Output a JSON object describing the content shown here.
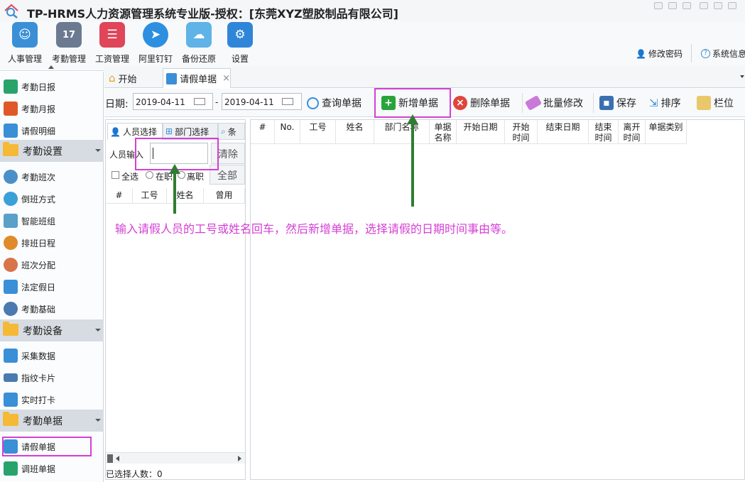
{
  "title": "TP-HRMS人力资源管理系统专业版-授权：[东莞XYZ塑胶制品有限公司]",
  "ribbon": [
    {
      "label": "人事管理",
      "icon": "people-icon",
      "color": "#3a8fd6"
    },
    {
      "label": "考勤管理",
      "icon": "calendar-icon",
      "color": "#6b7a91",
      "active": true
    },
    {
      "label": "工资管理",
      "icon": "payroll-icon",
      "color": "#e0455a"
    },
    {
      "label": "阿里钉钉",
      "icon": "dingtalk-icon",
      "color": "#2d8fe0"
    },
    {
      "label": "备份还原",
      "icon": "cloud-icon",
      "color": "#5fb3e6"
    },
    {
      "label": "设置",
      "icon": "gear-icon",
      "color": "#2f86d9"
    }
  ],
  "top_links": {
    "change_password": "修改密码",
    "system_info": "系统信息"
  },
  "sidebar": {
    "items1": [
      {
        "label": "考勤日报",
        "icon": "book-icon",
        "color": "#2aa36b"
      },
      {
        "label": "考勤月报",
        "icon": "bar-chart-icon",
        "color": "#e0582a"
      },
      {
        "label": "请假明细",
        "icon": "leave-detail-icon",
        "color": "#3a8fd6"
      }
    ],
    "group1": "考勤设置",
    "items2": [
      {
        "label": "考勤班次",
        "icon": "clock-icon",
        "color": "#4a90c8"
      },
      {
        "label": "倒班方式",
        "icon": "rotate-icon",
        "color": "#3aa0d8"
      },
      {
        "label": "智能班组",
        "icon": "smart-group-icon",
        "color": "#5aa0c8"
      },
      {
        "label": "排班日程",
        "icon": "stopwatch-icon",
        "color": "#e08a2a"
      },
      {
        "label": "班次分配",
        "icon": "user-assign-icon",
        "color": "#d9734a"
      },
      {
        "label": "法定假日",
        "icon": "holiday-icon",
        "color": "#3a8fd6"
      },
      {
        "label": "考勤基础",
        "icon": "gear-icon",
        "color": "#4a7ab0"
      }
    ],
    "group2": "考勤设备",
    "items3": [
      {
        "label": "采集数据",
        "icon": "download-icon",
        "color": "#3a8fd6"
      },
      {
        "label": "指纹卡片",
        "icon": "card-icon",
        "color": "#4a7ab0"
      },
      {
        "label": "实时打卡",
        "icon": "monitor-icon",
        "color": "#3a8fd6"
      }
    ],
    "group3": "考勤单据",
    "items4": [
      {
        "label": "请假单据",
        "icon": "leave-form-icon",
        "color": "#3a8fd6",
        "selected": true
      },
      {
        "label": "调班单据",
        "icon": "shift-form-icon",
        "color": "#2aa36b"
      }
    ]
  },
  "tabs": {
    "home": "开始",
    "leave": "请假单据",
    "close": "×"
  },
  "toolbar": {
    "date_label": "日期:",
    "date_from": "2019-04-11",
    "date_sep": "-",
    "date_to": "2019-04-11",
    "query": "查询单据",
    "add": "新增单据",
    "delete": "删除单据",
    "batch": "批量修改",
    "save": "保存",
    "sort": "排序",
    "columns": "栏位"
  },
  "left_panel": {
    "tab_people": "人员选择",
    "tab_dept": "部门选择",
    "tab_cond": "条",
    "input_label": "人员输入",
    "input_value": "",
    "clear": "清除",
    "select_all": "全选",
    "on_job": "在职",
    "resigned": "离职",
    "all": "全部",
    "headers": [
      "#",
      "工号",
      "姓名",
      "曾用"
    ],
    "selected_count": "已选择人数：0"
  },
  "grid": {
    "headers": [
      "#",
      "No.",
      "工号",
      "姓名",
      "部门名称",
      "单据名称",
      "开始日期",
      "开始时间",
      "结束日期",
      "结束时间",
      "离开时间",
      "单据类别"
    ]
  },
  "annotation": "输入请假人员的工号或姓名回车，然后新增单据，选择请假的日期时间事由等。",
  "colors": {
    "highlight": "#d43fd4",
    "arrow": "#2e7d32"
  }
}
